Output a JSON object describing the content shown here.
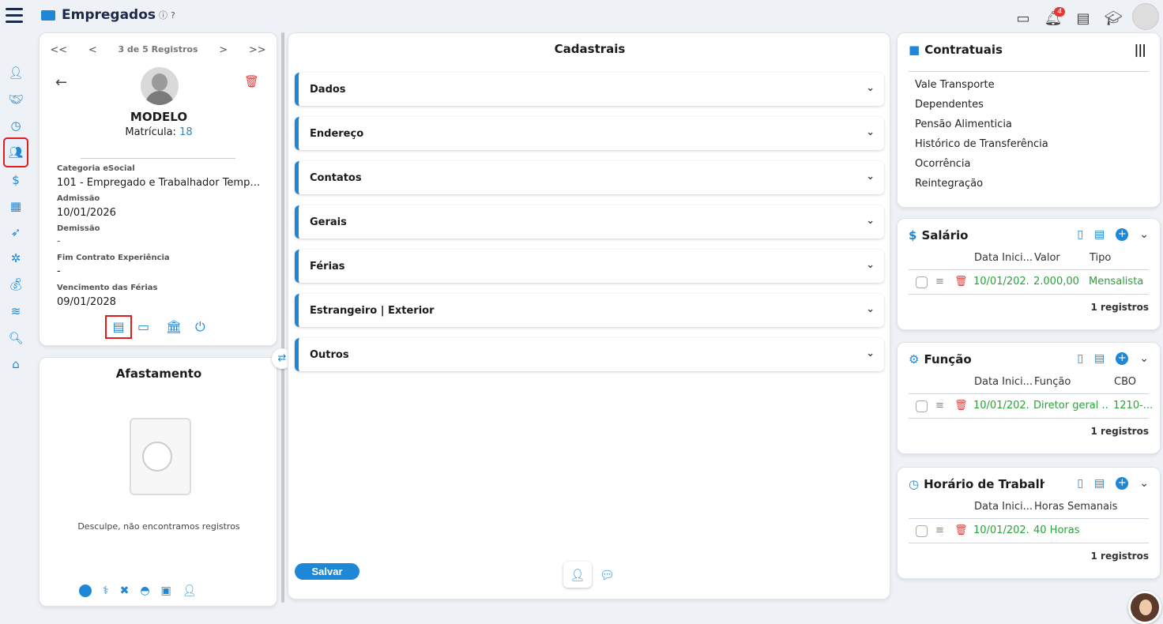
{
  "header": {
    "title": "Empregados",
    "notifications": "4"
  },
  "nav": {
    "first": "<<",
    "prev": "<",
    "info": "3 de 5 Registros",
    "next": ">",
    "last": ">>"
  },
  "employee": {
    "name": "MODELO",
    "matricula_label": "Matrícula:",
    "matricula": "18",
    "fields": [
      {
        "label": "Categoria eSocial",
        "value": "101 - Empregado e Trabalhador Tempo..."
      },
      {
        "label": "Admissão",
        "value": "10/01/2026"
      },
      {
        "label": "Demissão",
        "value": "-"
      },
      {
        "label": "Fim Contrato Experiência",
        "value": "-"
      },
      {
        "label": "Vencimento das Férias",
        "value": "09/01/2028"
      }
    ]
  },
  "afastamento": {
    "title": "Afastamento",
    "empty": "Desculpe, não encontramos registros"
  },
  "cadastrais": {
    "title": "Cadastrais",
    "sections": [
      "Dados",
      "Endereço",
      "Contatos",
      "Gerais",
      "Férias",
      "Estrangeiro | Exterior",
      "Outros"
    ],
    "save": "Salvar"
  },
  "contratuais": {
    "title": "Contratuais",
    "links": [
      "Vale Transporte",
      "Dependentes",
      "Pensão Alimenticia",
      "Histórico de Transferência",
      "Ocorrência",
      "Reintegração"
    ]
  },
  "salario": {
    "title": "Salário",
    "cols": [
      "Data Inici...",
      "Valor",
      "Tipo"
    ],
    "row": [
      "10/01/202...",
      "2.000,00",
      "Mensalista"
    ],
    "count": "1 registros"
  },
  "funcao": {
    "title": "Função",
    "cols": [
      "Data Inici...",
      "Função",
      "CBO"
    ],
    "row": [
      "10/01/202...",
      "Diretor geral ...",
      "1210-..."
    ],
    "count": "1 registros"
  },
  "horario": {
    "title": "Horário de Trabalho",
    "cols": [
      "Data Inici...",
      "Horas Semanais"
    ],
    "row": [
      "10/01/202...",
      "40 Horas"
    ],
    "count": "1 registros"
  },
  "colors": {
    "accent": "#1e88d6",
    "green": "#2aa33a",
    "danger": "#e53935"
  }
}
